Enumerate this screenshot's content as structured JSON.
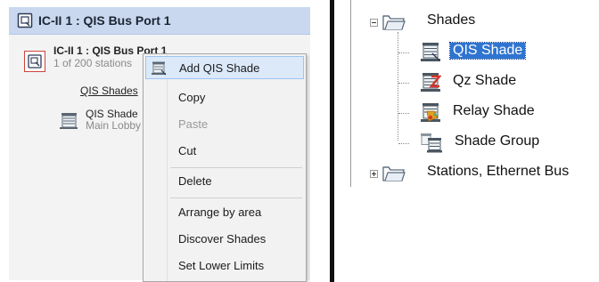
{
  "left_panel": {
    "header_title": "IC-II 1 : QIS Bus Port 1",
    "device_title": "IC-II 1 : QIS Bus Port 1",
    "device_subtitle": "1 of 200 stations",
    "category_link": "QIS Shades",
    "shade_item": {
      "name": "QIS Shade",
      "location": "Main Lobby"
    }
  },
  "context_menu": {
    "items": [
      {
        "label": "Add QIS Shade",
        "highlighted": true,
        "disabled": false,
        "icon": "add-shade-icon"
      },
      {
        "label": "Copy",
        "highlighted": false,
        "disabled": false
      },
      {
        "label": "Paste",
        "highlighted": false,
        "disabled": true
      },
      {
        "label": "Cut",
        "highlighted": false,
        "disabled": false
      },
      {
        "label": "Delete",
        "highlighted": false,
        "disabled": false
      },
      {
        "label": "Arrange by area",
        "highlighted": false,
        "disabled": false
      },
      {
        "label": "Discover Shades",
        "highlighted": false,
        "disabled": false
      },
      {
        "label": "Set Lower Limits",
        "highlighted": false,
        "disabled": false
      }
    ]
  },
  "tree": {
    "shades_folder": {
      "label": "Shades",
      "expander": "minus",
      "icon": "folder-icon"
    },
    "children": [
      {
        "label": "QIS Shade",
        "selected": true,
        "icon": "qis-shade-icon"
      },
      {
        "label": "Qz Shade",
        "selected": false,
        "icon": "qz-shade-icon"
      },
      {
        "label": "Relay Shade",
        "selected": false,
        "icon": "relay-shade-icon"
      },
      {
        "label": "Shade Group",
        "selected": false,
        "icon": "shade-group-icon"
      }
    ],
    "stations_folder": {
      "label": "Stations, Ethernet Bus",
      "expander": "plus",
      "icon": "folder-icon"
    }
  },
  "colors": {
    "header_bg": "#c9d8ef",
    "selection": "#2f74d0",
    "menu_highlight": "#dbe9f9",
    "device_border": "#d0433b"
  }
}
